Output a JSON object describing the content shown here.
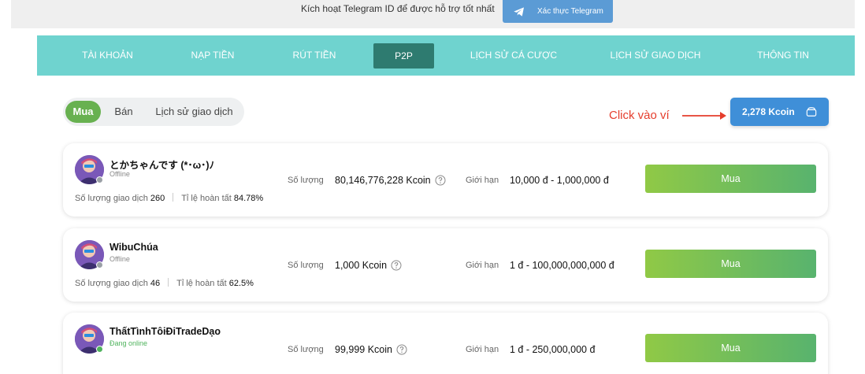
{
  "banner": {
    "text": "Kích hoạt Telegram ID để được hỗ trợ tốt nhất",
    "telegram_button": "Xác thực Telegram",
    "telegram_icon": "telegram-icon"
  },
  "nav": {
    "items": [
      {
        "label": "TÀI KHOẢN"
      },
      {
        "label": "NẠP TIỀN"
      },
      {
        "label": "RÚT TIỀN"
      },
      {
        "label": "P2P",
        "active": true
      },
      {
        "label": "LỊCH SỬ CÁ CƯỢC"
      },
      {
        "label": "LỊCH SỬ GIAO DỊCH"
      },
      {
        "label": "THÔNG TIN"
      }
    ]
  },
  "tabs": [
    {
      "label": "Mua",
      "active": true
    },
    {
      "label": "Bán"
    },
    {
      "label": "Lịch sử giao dịch"
    }
  ],
  "annotation": {
    "text": "Click vào ví",
    "color": "#e53d2c"
  },
  "wallet": {
    "label": "2,278 Kcoin",
    "icon": "wallet-icon"
  },
  "labels": {
    "quantity": "Số lượng",
    "limit": "Giới hạn",
    "trades": "Số lượng giao dịch",
    "completion": "Tỉ lệ hoàn tất",
    "buy": "Mua"
  },
  "sellers": [
    {
      "name": "とかちゃんです (*･ω･)ﾉ",
      "status": "Offline",
      "online": false,
      "trades": "260",
      "completion": "84.78%",
      "quantity": "80,146,776,228 Kcoin",
      "limit": "10,000 đ - 1,000,000 đ"
    },
    {
      "name": "WibuChúa",
      "status": "Offline",
      "online": false,
      "trades": "46",
      "completion": "62.5%",
      "quantity": "1,000 Kcoin",
      "limit": "1 đ - 100,000,000,000 đ"
    },
    {
      "name": "ThấtTìnhTôiĐiTradeDạo",
      "status": "Đang online",
      "online": true,
      "quantity": "99,999 Kcoin",
      "limit": "1 đ - 250,000,000 đ"
    }
  ],
  "colors": {
    "nav_bg": "#6fd3cf",
    "nav_active": "#2e7b70",
    "tab_active": "#68b150",
    "wallet_button": "#3f8fd8",
    "buy_gradient_start": "#90c946",
    "buy_gradient_end": "#58b36e"
  }
}
